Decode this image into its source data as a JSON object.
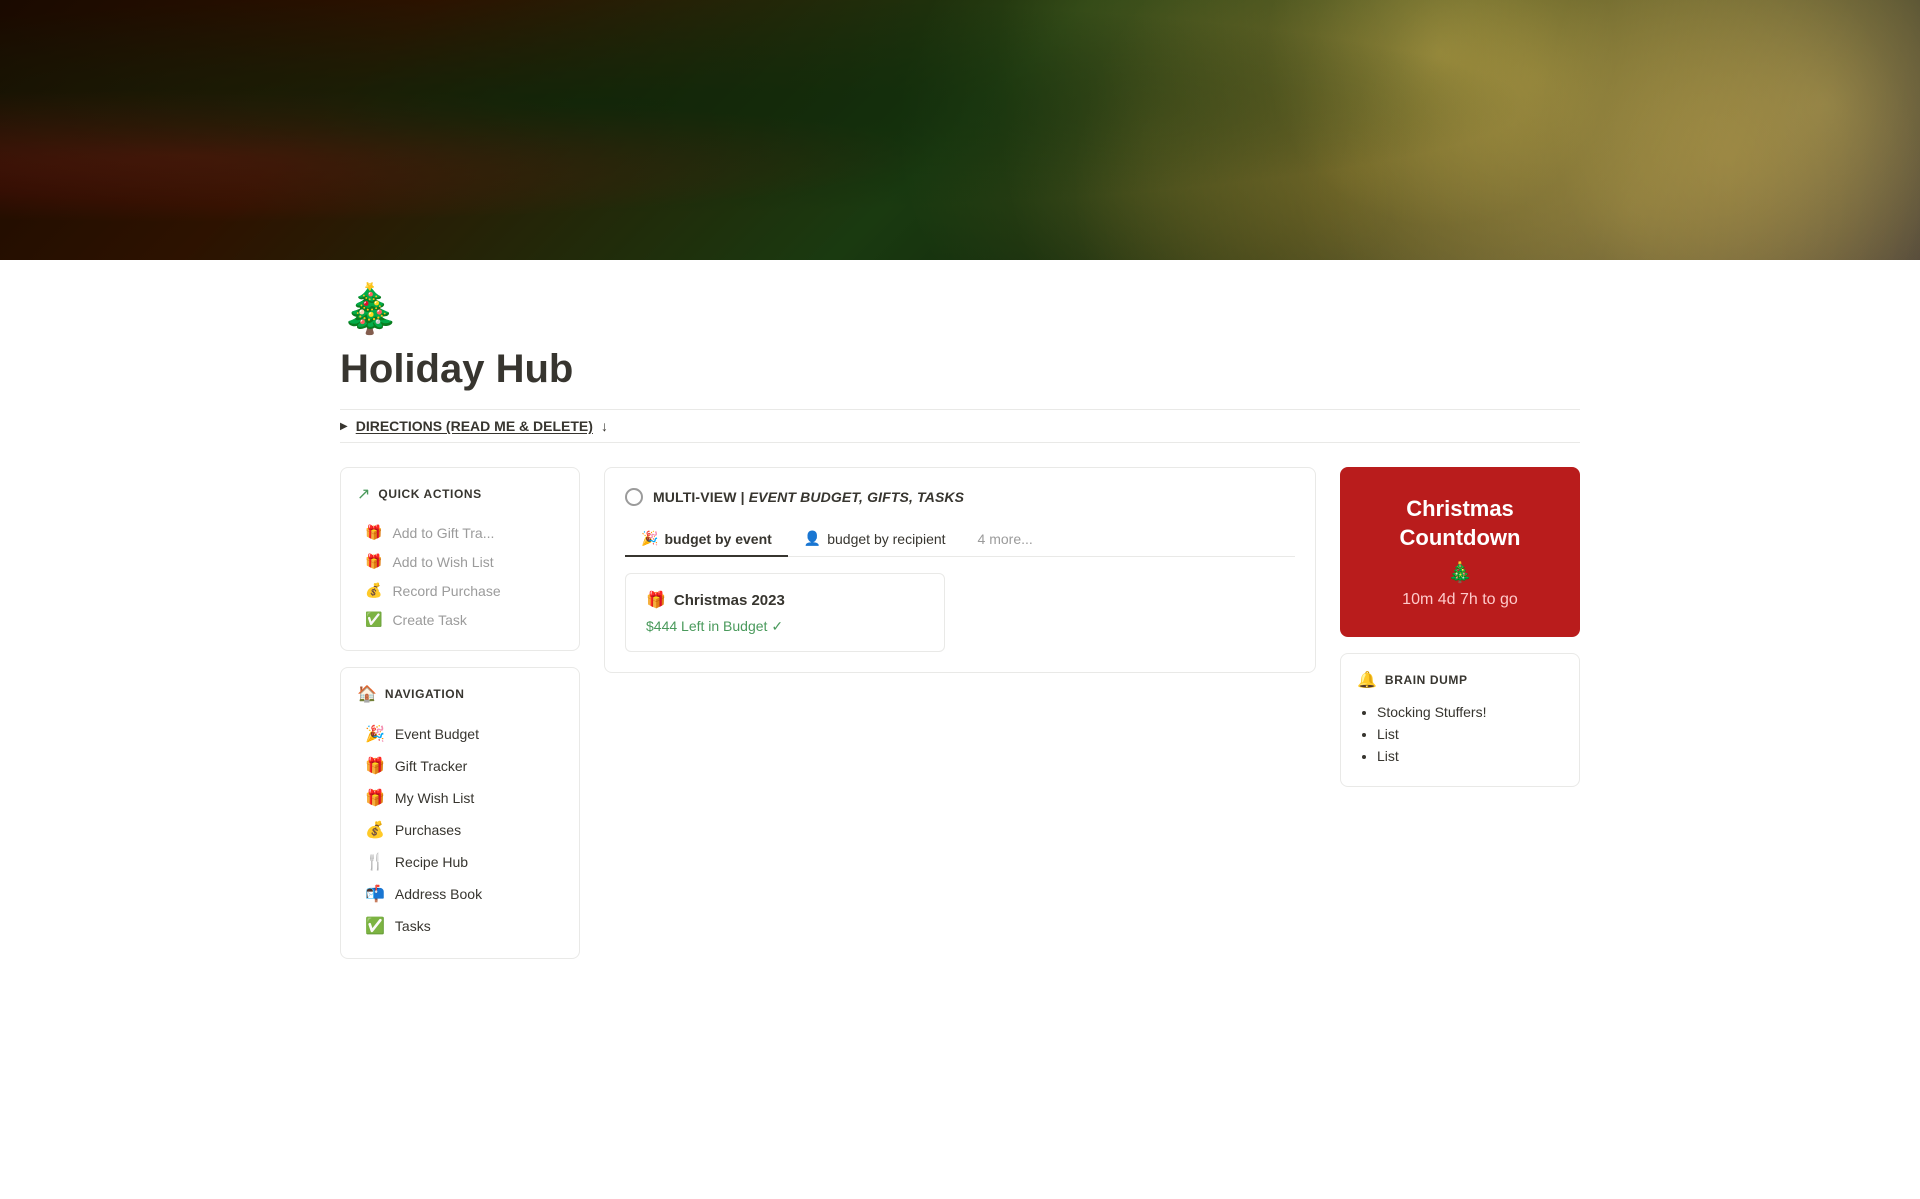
{
  "hero": {
    "alt": "Christmas tree with bokeh lights"
  },
  "page": {
    "icon": "🎄",
    "title": "Holiday Hub",
    "directions_label": "DIRECTIONS (READ ME & DELETE)",
    "directions_arrow": "↓"
  },
  "quick_actions": {
    "header_icon": "↗",
    "header_title": "QUICK ACTIONS",
    "items": [
      {
        "icon": "🎁",
        "label": "Add to Gift Tra..."
      },
      {
        "icon": "🎁",
        "label": "Add to Wish List"
      },
      {
        "icon": "💰",
        "label": "Record Purchase"
      },
      {
        "icon": "✅",
        "label": "Create Task"
      }
    ]
  },
  "navigation": {
    "header_icon": "🏠",
    "header_title": "NAVIGATION",
    "items": [
      {
        "icon": "🎉",
        "label": "Event Budget"
      },
      {
        "icon": "🎁",
        "label": "Gift Tracker"
      },
      {
        "icon": "🎁",
        "label": "My Wish List"
      },
      {
        "icon": "💰",
        "label": "Purchases"
      },
      {
        "icon": "🍴",
        "label": "Recipe Hub"
      },
      {
        "icon": "📬",
        "label": "Address Book"
      },
      {
        "icon": "✅",
        "label": "Tasks"
      }
    ]
  },
  "multiview": {
    "circle_empty": true,
    "title_prefix": "MULTI-VIEW | ",
    "title_italic": "EVENT BUDGET, GIFTS, TASKS",
    "tabs": [
      {
        "icon": "🎉",
        "label": "budget by event",
        "active": true
      },
      {
        "icon": "👤",
        "label": "budget by recipient",
        "active": false
      }
    ],
    "more_label": "4 more...",
    "data_card": {
      "icon": "🎁",
      "title": "Christmas 2023",
      "budget_text": "$444 Left in Budget ✓"
    }
  },
  "countdown": {
    "title": "Christmas Countdown",
    "tree_emoji": "🎄",
    "time_label": "10m 4d 7h to go"
  },
  "brain_dump": {
    "header_icon": "🔔",
    "header_title": "BRAIN DUMP",
    "items": [
      "Stocking Stuffers!",
      "List",
      "List"
    ]
  }
}
